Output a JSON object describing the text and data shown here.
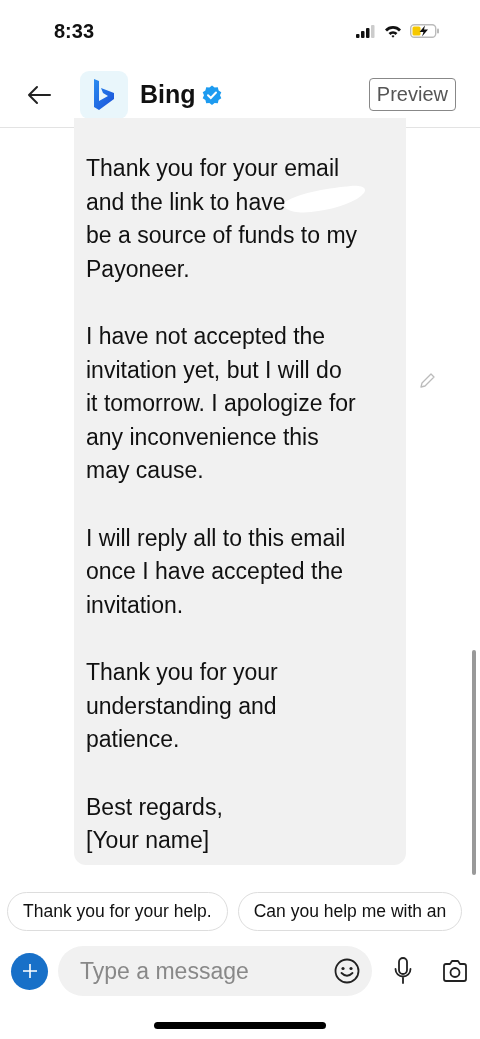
{
  "status_bar": {
    "time": "8:33"
  },
  "header": {
    "title": "Bing",
    "verified": true,
    "preview_button": "Preview"
  },
  "message": {
    "paragraphs": [
      {
        "lines": [
          "Thank you for your email",
          {
            "text": "and the link to have",
            "redacted": true
          },
          "be a source of funds to my",
          "Payoneer."
        ]
      },
      {
        "lines": [
          "I have not accepted the",
          "invitation yet, but I will do",
          "it tomorrow. I apologize for",
          "any inconvenience this",
          "may cause."
        ]
      },
      {
        "lines": [
          "I will reply all to this email",
          "once I have accepted the",
          "invitation."
        ]
      },
      {
        "lines": [
          "Thank you for your",
          "understanding and",
          "patience."
        ]
      },
      {
        "lines": [
          "Best regards,",
          "[Your name]"
        ]
      }
    ]
  },
  "suggestions": [
    "Thank you for your help.",
    "Can you help me with an"
  ],
  "composer": {
    "placeholder": "Type a message"
  }
}
